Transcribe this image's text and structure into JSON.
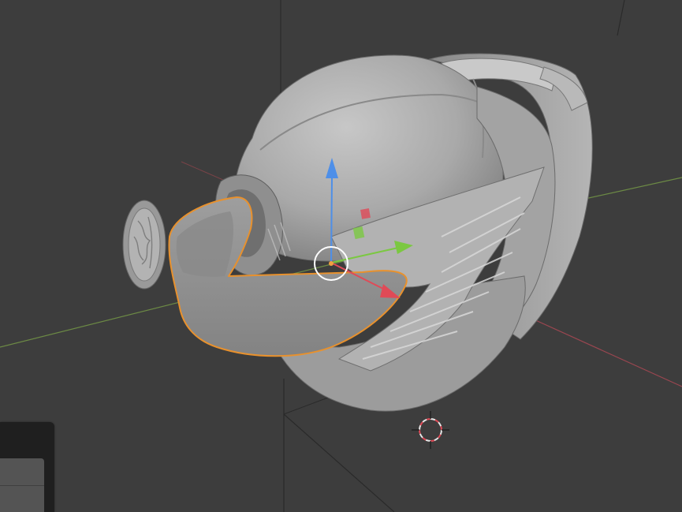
{
  "app": "3D viewport",
  "viewport": {
    "background_color": "#3d3d3d",
    "selected_object": "visor",
    "selection_outline_color": "#e8912d",
    "gizmo": {
      "x_axis_color": "#e04a57",
      "y_axis_color": "#7bc841",
      "z_axis_color": "#4e8fe8",
      "origin_icon": "object-origin-icon",
      "cursor_icon": "3d-cursor-icon"
    },
    "model": {
      "name": "helmet",
      "body_color": "#a8a8a8"
    }
  },
  "side_panel": {
    "rows": 2
  }
}
